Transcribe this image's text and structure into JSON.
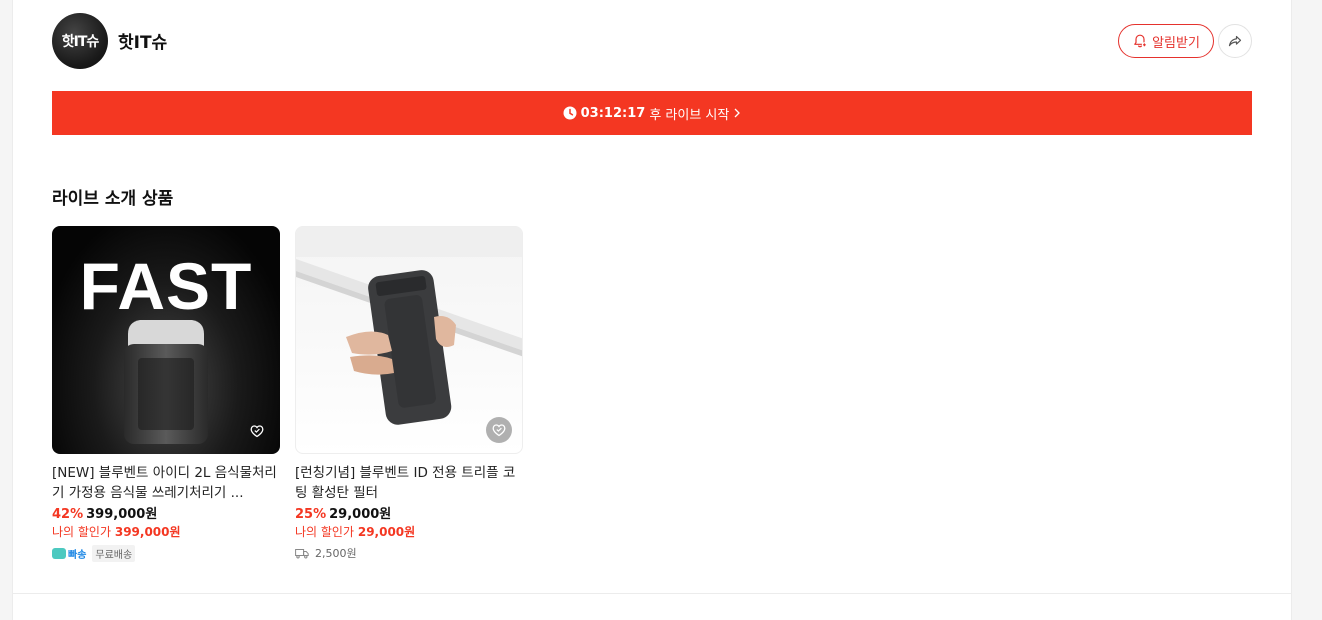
{
  "channel": {
    "avatar_text": "핫IT슈",
    "name": "핫IT슈",
    "notify_label": "알림받기"
  },
  "icons": {
    "bell": "bell-plus-icon",
    "share": "share-arrow-icon",
    "clock": "clock-icon",
    "chevron": "chevron-right-icon",
    "heart": "heart-check-icon",
    "truck": "truck-icon"
  },
  "live": {
    "countdown": "03:12:17",
    "text": "후 라이브 시작"
  },
  "section": {
    "title": "라이브 소개 상품"
  },
  "products": [
    {
      "image_text": "FAST",
      "title": "[NEW] 블루벤트 아이디 2L 음식물처리기 가정용 음식물 쓰레기처리기 ...",
      "discount": "42%",
      "price": "399,000원",
      "my_price_label": "나의 할인가",
      "my_price": "399,000원",
      "delivery_badge": "빠송",
      "shipping": "무료배송"
    },
    {
      "title": "[런칭기념] 블루벤트 ID 전용 트리플 코팅 활성탄 필터",
      "discount": "25%",
      "price": "29,000원",
      "my_price_label": "나의 할인가",
      "my_price": "29,000원",
      "shipping": "2,500원"
    }
  ],
  "colors": {
    "accent": "#f43722",
    "notify_border": "#e5322d"
  }
}
